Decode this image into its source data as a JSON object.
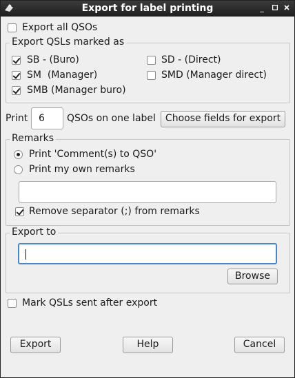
{
  "window": {
    "title": "Export for label printing"
  },
  "export_all": {
    "label": "Export all QSOs",
    "checked": false
  },
  "marked_group": {
    "title": "Export QSLs marked as",
    "sb": {
      "label": "SB - (Buro)",
      "checked": true
    },
    "sd": {
      "label": "SD - (Direct)",
      "checked": false
    },
    "sm": {
      "label": "SM  (Manager)",
      "checked": true
    },
    "smd": {
      "label": "SMD (Manager direct)",
      "checked": false
    },
    "smb": {
      "label": "SMB (Manager buro)",
      "checked": true
    }
  },
  "print_row": {
    "prefix": "Print",
    "count": "6",
    "suffix": "QSOs on one label",
    "choose_fields_label": "Choose fields for export"
  },
  "remarks": {
    "title": "Remarks",
    "print_comments": {
      "label": "Print 'Comment(s) to QSO'",
      "checked": true
    },
    "print_own": {
      "label": "Print my own remarks",
      "checked": false
    },
    "own_value": "",
    "remove_separator": {
      "label": "Remove separator (;) from remarks",
      "checked": true
    }
  },
  "export_to": {
    "title": "Export to",
    "value": "",
    "browse_label": "Browse"
  },
  "mark_sent": {
    "label": "Mark QSLs sent after export",
    "checked": false
  },
  "buttons": {
    "export": "Export",
    "help": "Help",
    "cancel": "Cancel"
  }
}
